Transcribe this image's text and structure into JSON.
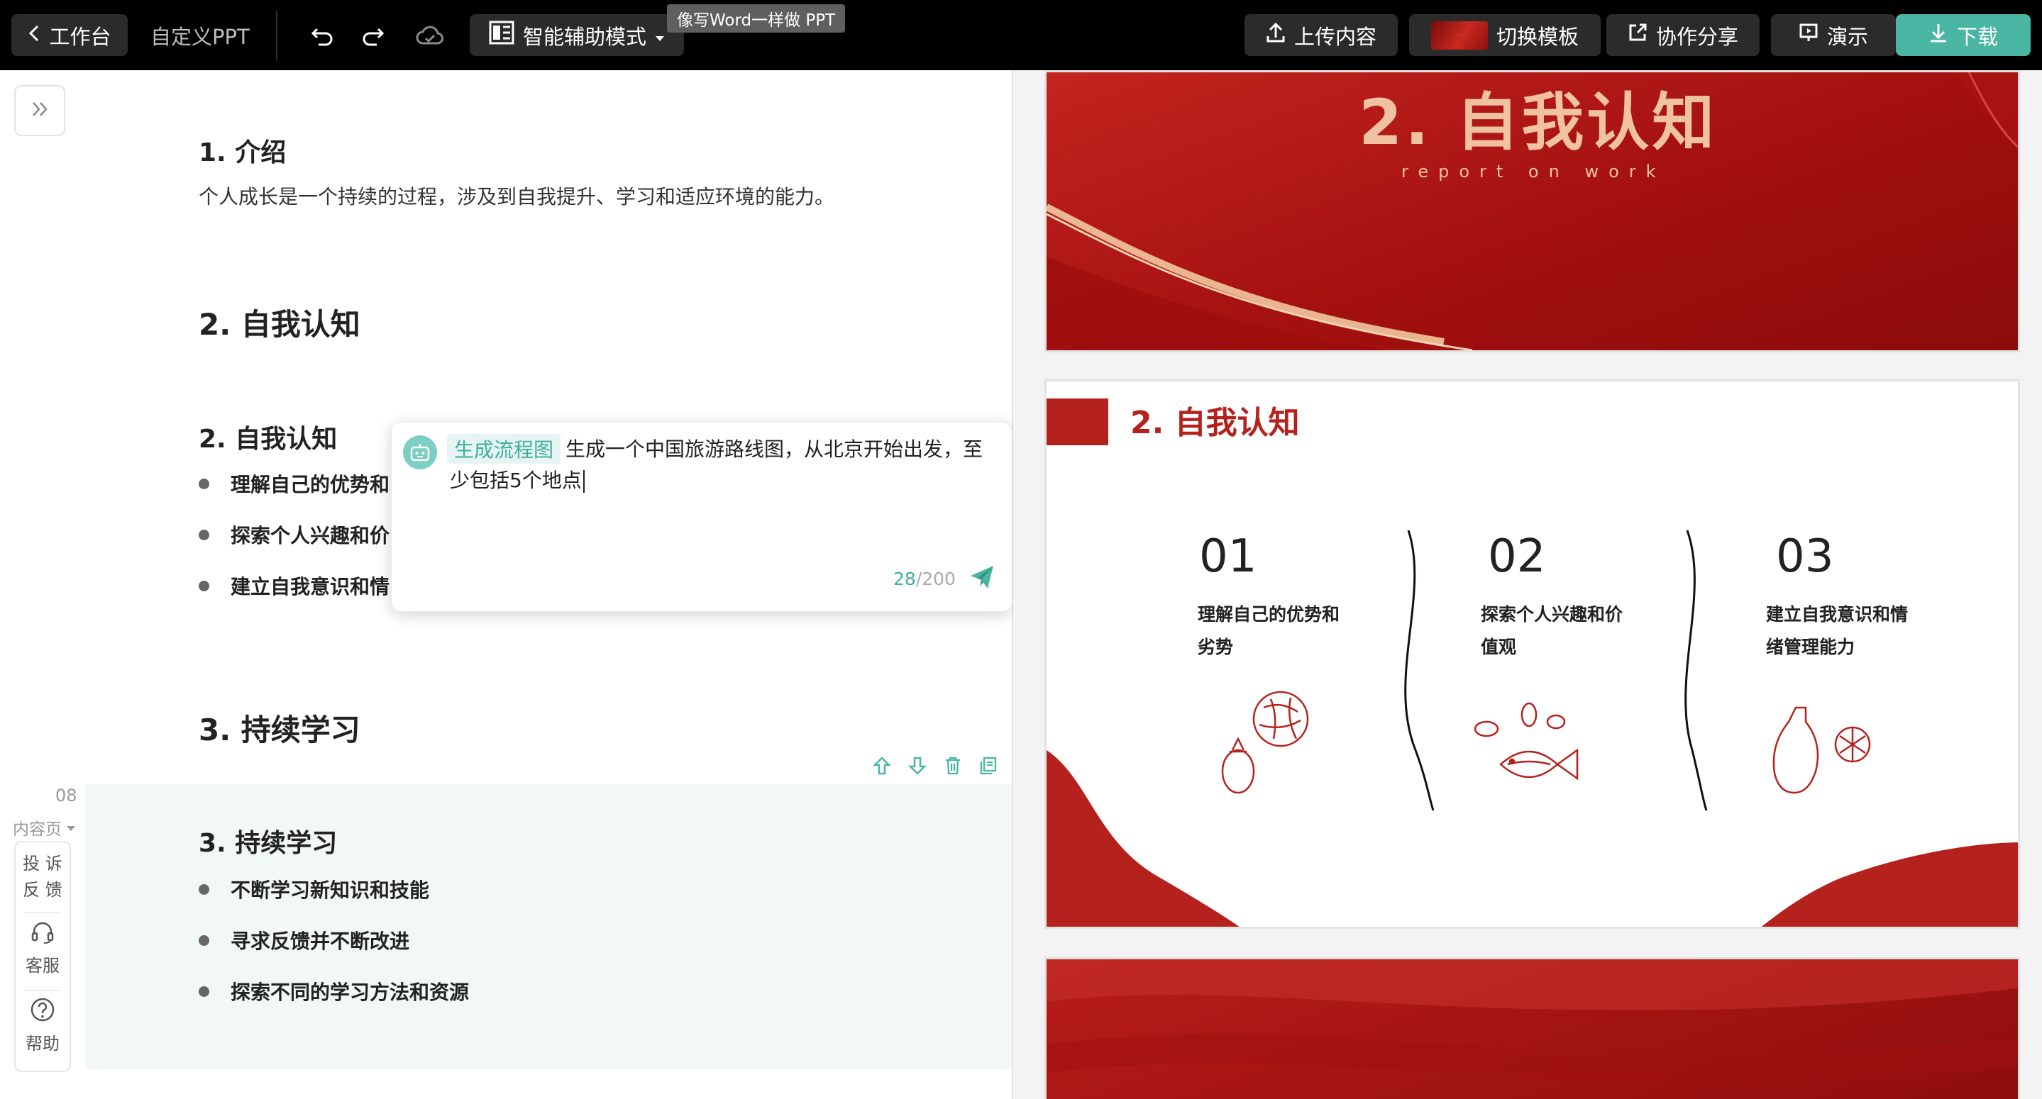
{
  "toolbar": {
    "back_label": "工作台",
    "doc_title": "自定义PPT",
    "mode_label": "智能辅助模式",
    "tooltip": "像写Word一样做 PPT",
    "upload_label": "上传内容",
    "switch_template_label": "切换模板",
    "share_label": "协作分享",
    "present_label": "演示",
    "download_label": "下载"
  },
  "editor": {
    "sec1_title": "1. 介绍",
    "sec1_text": "个人成长是一个持续的过程，涉及到自我提升、学习和适应环境的能力。",
    "sec2_title": "2. 自我认知",
    "sec2_sub": "2. 自我认知",
    "sec2_bullets": [
      "理解自己的优势和",
      "探索个人兴趣和价",
      "建立自我意识和情"
    ],
    "sec3_title": "3. 持续学习",
    "sec3_sub": "3. 持续学习",
    "sec3_bullets": [
      "不断学习新知识和技能",
      "寻求反馈并不断改进",
      "探索不同的学习方法和资源"
    ],
    "page_number": "08",
    "page_type": "内容页"
  },
  "side_tools": {
    "feedback_line1": "投 诉",
    "feedback_line2": "反 馈",
    "service_label": "客服",
    "help_label": "帮助"
  },
  "ai_popup": {
    "tag": "生成流程图",
    "text_line1": "生成一个中国旅游路线图，从北京开始出发，至",
    "text_line2": "少包括5个地点",
    "count_current": "28",
    "count_max": "/200"
  },
  "slides": {
    "s1_title": "2.   自我认知",
    "s1_subtitle": "report on work",
    "s2_title": "2. 自我认知",
    "s2_items": [
      {
        "num": "01",
        "line1": "理解自己的优势和",
        "line2": "劣势"
      },
      {
        "num": "02",
        "line1": "探索个人兴趣和价",
        "line2": "值观"
      },
      {
        "num": "03",
        "line1": "建立自我意识和情",
        "line2": "绪管理能力"
      }
    ]
  },
  "colors": {
    "accent": "#4ab5a2",
    "slide_red": "#b5221d",
    "slide_gold": "#f1c2a1"
  }
}
